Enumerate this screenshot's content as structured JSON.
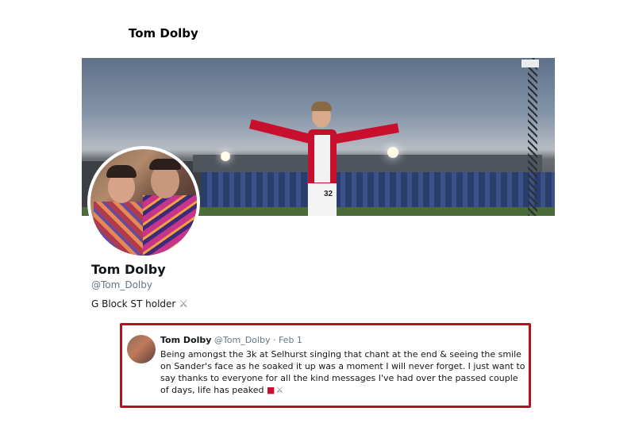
{
  "header": {
    "title": "Tom Dolby"
  },
  "banner": {
    "shirt_number": "32"
  },
  "profile": {
    "name": "Tom Dolby",
    "handle": "@Tom_Dolby",
    "bio": "G Block ST holder",
    "bio_icon": "crossed-swords-icon"
  },
  "tweet": {
    "name": "Tom Dolby",
    "handle": "@Tom_Dolby",
    "separator": " · ",
    "date": "Feb 1",
    "text": "Being amongst the 3k at Selhurst singing that chant at the end & seeing the smile on Sander's face as he soaked it up was a moment I will never forget. I just want to say thanks to everyone for all the kind messages I've had over the passed couple of days, life has peaked",
    "emoji_icons": [
      "norway-flag-icon",
      "crossed-swords-icon"
    ]
  },
  "colors": {
    "highlight_border": "#b0141f",
    "handle_gray": "#657786",
    "text": "#14171a"
  }
}
